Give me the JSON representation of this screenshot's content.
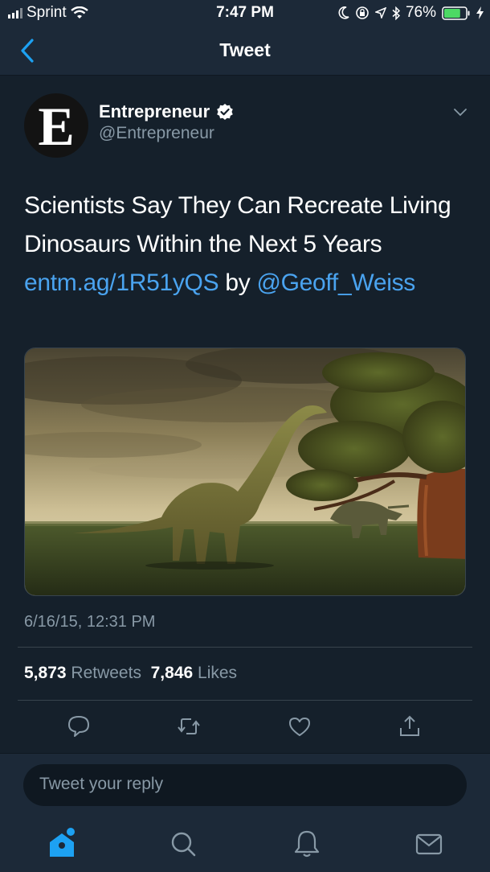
{
  "status_bar": {
    "carrier": "Sprint",
    "time": "7:47 PM",
    "battery": "76%",
    "battery_level": 0.76
  },
  "nav": {
    "back_icon": "chevron-left-icon",
    "title": "Tweet"
  },
  "tweet": {
    "avatar_letter": "E",
    "author_name": "Entrepreneur",
    "verified": true,
    "handle": "@Entrepreneur",
    "text_before": "Scientists Say They Can Recreate Living Dinosaurs Within the Next 5 Years ",
    "link": "entm.ag/1R51yQS",
    "text_mid": " by ",
    "mention": "@Geoff_Weiss",
    "timestamp": "6/16/15, 12:31 PM",
    "retweets_count": "5,873",
    "retweets_label": "Retweets",
    "likes_count": "7,846",
    "likes_label": "Likes",
    "actions": [
      "reply-icon",
      "retweet-icon",
      "like-icon",
      "share-icon"
    ]
  },
  "reply": {
    "placeholder": "Tweet your reply"
  },
  "tab_bar": [
    "home-icon",
    "search-icon",
    "notifications-icon",
    "messages-icon"
  ],
  "colors": {
    "background": "#15202b",
    "bar": "#1c2938",
    "accent": "#1da1f2",
    "link": "#4aa3ef",
    "muted": "#8899a6"
  }
}
